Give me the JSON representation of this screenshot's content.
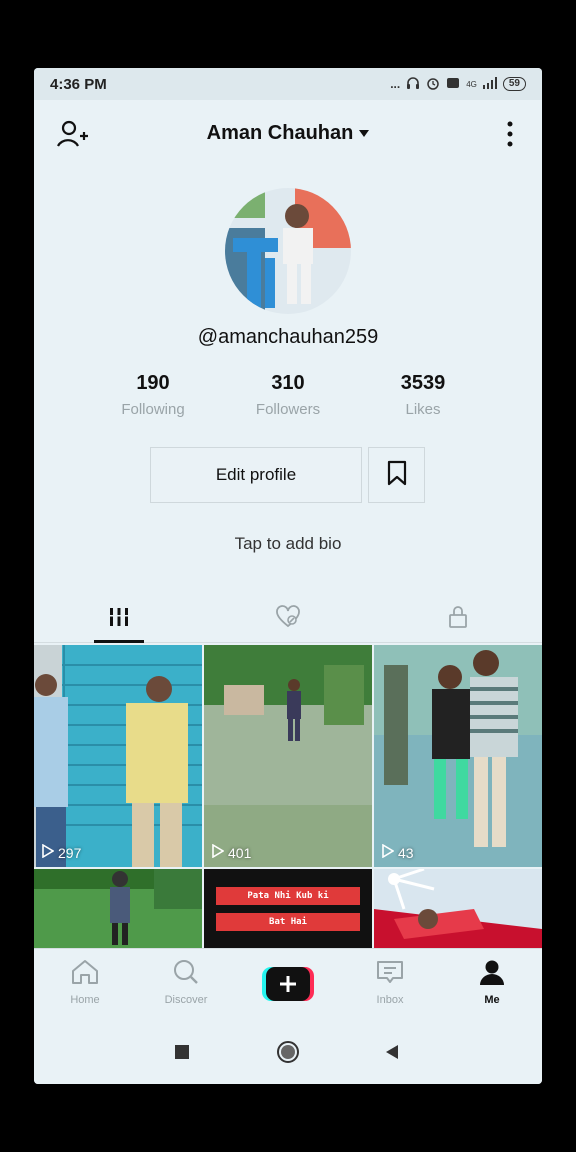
{
  "status_bar": {
    "time": "4:36 PM",
    "dots": "...",
    "network": "4G",
    "battery": "59"
  },
  "header": {
    "title": "Aman Chauhan"
  },
  "profile": {
    "username": "@amanchauhan259",
    "stats": [
      {
        "value": "190",
        "label": "Following"
      },
      {
        "value": "310",
        "label": "Followers"
      },
      {
        "value": "3539",
        "label": "Likes"
      }
    ],
    "edit_label": "Edit profile",
    "bio_prompt": "Tap to add bio"
  },
  "videos": [
    {
      "views": "297"
    },
    {
      "views": "401"
    },
    {
      "views": "43"
    },
    {
      "views": ""
    },
    {
      "overlay_lines": [
        "Pata Nhi Kub ki",
        "Bat Hai"
      ]
    },
    {
      "views": ""
    }
  ],
  "bottom_nav": {
    "home": "Home",
    "discover": "Discover",
    "inbox": "Inbox",
    "me": "Me"
  },
  "colors": {
    "accent_cyan": "#25f4ee",
    "accent_red": "#fe2c55",
    "background": "#e9f2f6"
  }
}
